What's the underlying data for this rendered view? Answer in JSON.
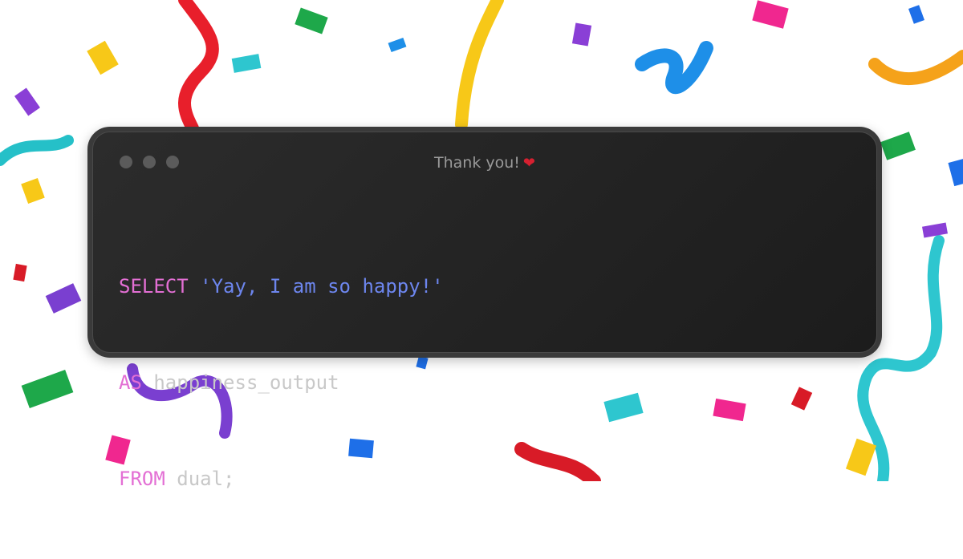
{
  "window": {
    "title": "Thank you!",
    "title_icon": "heart-icon",
    "controls": [
      "close-dot",
      "minimize-dot",
      "maximize-dot"
    ]
  },
  "code": {
    "lines": [
      {
        "keyword": "SELECT",
        "space": " ",
        "string": "'Yay, I am so happy!'",
        "rest": ""
      },
      {
        "keyword": "AS",
        "space": " ",
        "string": "",
        "rest": "happiness_output"
      },
      {
        "keyword": "FROM",
        "space": " ",
        "string": "",
        "rest": "dual;"
      }
    ]
  },
  "colors": {
    "keyword": "#e36fd4",
    "string": "#6d86ee",
    "text": "#c8c8c8",
    "window_bg": "#262626",
    "heart": "#d62030"
  },
  "background": {
    "decoration": "confetti-streamers"
  }
}
